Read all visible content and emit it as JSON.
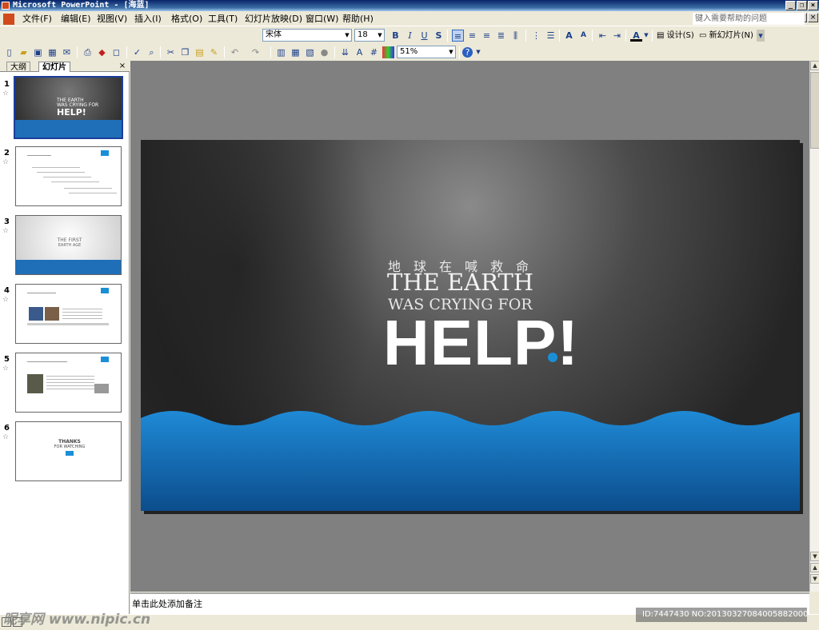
{
  "window": {
    "title": "Microsoft PowerPoint - [海蓝]"
  },
  "menu": {
    "items": [
      "文件(F)",
      "编辑(E)",
      "视图(V)",
      "插入(I)",
      "格式(O)",
      "工具(T)",
      "幻灯片放映(D)",
      "窗口(W)",
      "帮助(H)"
    ],
    "help_placeholder": "键入需要帮助的问题"
  },
  "formatting": {
    "font": "宋体",
    "size": "18",
    "design": "设计(S)",
    "new_slide": "新幻灯片(N)"
  },
  "standard": {
    "zoom": "51%"
  },
  "panel": {
    "tab_outline": "大纲",
    "tab_slides": "幻灯片",
    "slide_numbers": [
      "1",
      "2",
      "3",
      "4",
      "5",
      "6"
    ],
    "star": "☆"
  },
  "slide": {
    "cn": "地球在喊救命",
    "line1": "THE EARTH",
    "line2": "WAS CRYING FOR",
    "help": "HELP!"
  },
  "thumbs": {
    "t1": [
      "THE EARTH",
      "WAS CRYING FOR",
      "HELP!"
    ],
    "t3": [
      "THE FIRST",
      "EARTH AGE"
    ],
    "t6": [
      "THANKS",
      "FOR WATCHING"
    ]
  },
  "notes": {
    "placeholder": "单击此处添加备注"
  },
  "watermark": {
    "id": "ID:7447430 NO:20130327084005882000",
    "site": "昵享网 www.nipic.cn"
  },
  "colors": {
    "titlebar": "#0a246a",
    "accent": "#1a8fd6",
    "toolbar": "#ece9d8"
  }
}
